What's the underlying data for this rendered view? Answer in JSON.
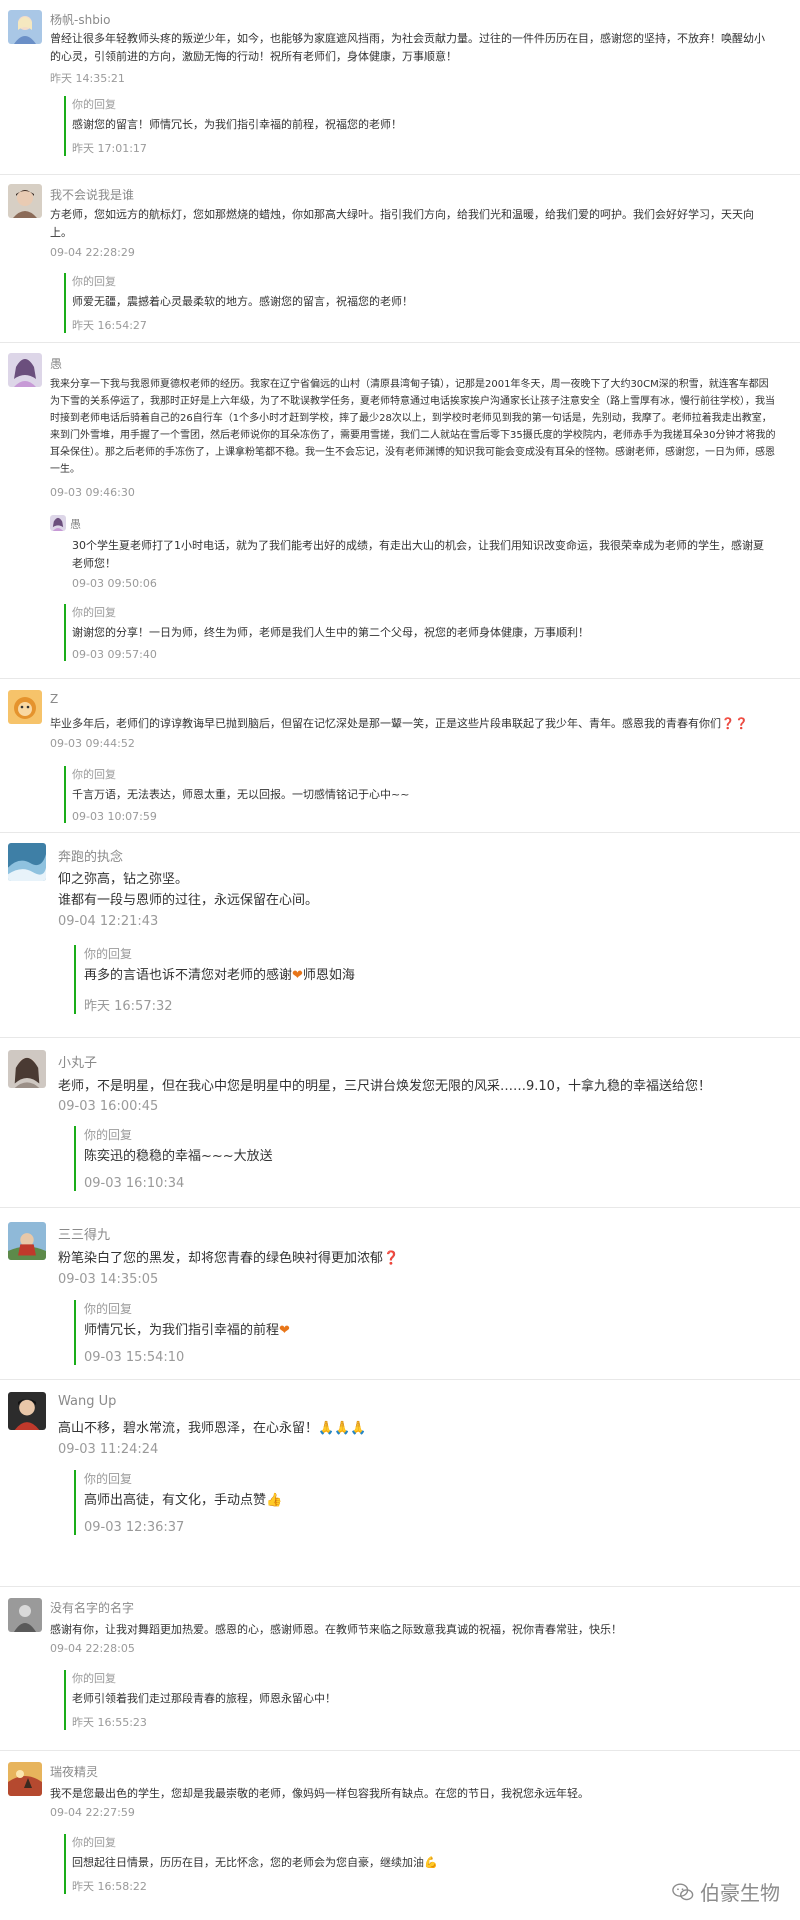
{
  "comments": [
    {
      "nickname": "杨帆-shbio",
      "text": "曾经让很多年轻教师头疼的叛逆少年，如今，也能够为家庭遮风挡雨，为社会贡献力量。过往的一件件历历在目，感谢您的坚持，不放弃！唤醒幼小的心灵，引领前进的方向，激励无悔的行动！祝所有老师们，身体健康，万事顺意！",
      "time": "昨天 14:35:21",
      "reply_label": "你的回复",
      "reply_text": "感谢您的留言！师情冗长，为我们指引幸福的前程，祝福您的老师！",
      "reply_time": "昨天 17:01:17"
    },
    {
      "nickname": "我不会说我是谁",
      "text": "方老师，您如远方的航标灯，您如那燃烧的蜡烛，你如那高大绿叶。指引我们方向，给我们光和温暖，给我们爱的呵护。我们会好好学习，天天向上。",
      "time": "09-04 22:28:29",
      "reply_label": "你的回复",
      "reply_text": "师爱无疆，震撼着心灵最柔软的地方。感谢您的留言，祝福您的老师！",
      "reply_time": "昨天 16:54:27"
    },
    {
      "nickname": "愚",
      "text": "我来分享一下我与我恩师夏德权老师的经历。我家在辽宁省偏远的山村（清原县湾甸子镇），记那是2001年冬天，周一夜晚下了大约30CM深的积雪，就连客车都因为下雪的关系停运了，我那时正好是上六年级，为了不耽误教学任务，夏老师特意通过电话挨家挨户沟通家长让孩子注意安全（路上雪厚有冰，慢行前往学校），我当时接到老师电话后骑着自己的26自行车（1个多小时才赶到学校，摔了最少28次以上，到学校时老师见到我的第一句话是，先别动，我摩了。老师拉着我走出教室，来到门外雪堆，用手握了一个雪团，然后老师说你的耳朵冻伤了，需要用雪搓，我们二人就站在雪后零下35摄氏度的学校院内，老师赤手为我搓耳朵30分钟才将我的耳朵保住）。那之后老师的手冻伤了，上课拿粉笔都不稳。我一生不会忘记，没有老师渊博的知识我可能会变成没有耳朵的怪物。感谢老师，感谢您，一日为师，感恩一生。",
      "time": "09-03 09:46:30",
      "follow_nick": "愚",
      "follow_text": "30个学生夏老师打了1小时电话，就为了我们能考出好的成绩，有走出大山的机会，让我们用知识改变命运，我很荣幸成为老师的学生，感谢夏老师您！",
      "follow_time": "09-03 09:50:06",
      "reply_label": "你的回复",
      "reply_text": "谢谢您的分享！一日为师，终生为师，老师是我们人生中的第二个父母，祝您的老师身体健康，万事顺利！",
      "reply_time": "09-03 09:57:40"
    },
    {
      "nickname": "Z",
      "text": "毕业多年后，老师们的谆谆教诲早已抛到脑后，但留在记忆深处是那一颦一笑，正是这些片段串联起了我少年、青年。感恩我的青春有你们",
      "time": "09-03 09:44:52",
      "reply_label": "你的回复",
      "reply_text": "千言万语，无法表达，师恩太重，无以回报。一切感情铭记于心中~~",
      "reply_time": "09-03 10:07:59"
    },
    {
      "nickname": "奔跑的执念",
      "text": "仰之弥高，钻之弥坚。\n谁都有一段与恩师的过往，永远保留在心间。",
      "time": "09-04 12:21:43",
      "reply_label": "你的回复",
      "reply_text_a": "再多的言语也诉不清您对老师的感谢",
      "reply_text_b": "师恩如海",
      "reply_time": "昨天 16:57:32"
    },
    {
      "nickname": "小丸子",
      "text": "老师，不是明星，但在我心中您是明星中的明星，三尺讲台焕发您无限的风采……9.10，十拿九稳的幸福送给您！",
      "time": "09-03 16:00:45",
      "reply_label": "你的回复",
      "reply_text": "陈奕迅的稳稳的幸福~~~大放送",
      "reply_time": "09-03 16:10:34"
    },
    {
      "nickname": "三三得九",
      "text": "粉笔染白了您的黑发，却将您青春的绿色映衬得更加浓郁",
      "time": "09-03 14:35:05",
      "reply_label": "你的回复",
      "reply_text": "师情冗长，为我们指引幸福的前程",
      "reply_time": "09-03 15:54:10"
    },
    {
      "nickname": "Wang Up",
      "text": "高山不移，碧水常流，我师恩泽，在心永留！",
      "time": "09-03 11:24:24",
      "reply_label": "你的回复",
      "reply_text": "高师出高徒，有文化，手动点赞",
      "reply_time": "09-03 12:36:37"
    },
    {
      "nickname": "没有名字的名字",
      "text": "感谢有你，让我对舞蹈更加热爱。感恩的心，感谢师恩。在教师节来临之际致意我真诚的祝福，祝你青春常驻，快乐！",
      "time": "09-04 22:28:05",
      "reply_label": "你的回复",
      "reply_text": "老师引领着我们走过那段青春的旅程，师恩永留心中！",
      "reply_time": "昨天 16:55:23"
    },
    {
      "nickname": "瑞夜精灵",
      "text": "我不是您最出色的学生，您却是我最崇敬的老师，像妈妈一样包容我所有缺点。在您的节日，我祝您永远年轻。",
      "time": "09-04 22:27:59",
      "reply_label": "你的回复",
      "reply_text": "回想起往日情景，历历在目，无比怀念，您的老师会为您自豪，继续加油",
      "reply_time": "昨天 16:58:22"
    }
  ],
  "watermark": {
    "text": "伯豪生物"
  },
  "colors": {
    "reply_bar": "#1aad19",
    "heart": "#e8761a",
    "qmark": "#d22e2e"
  },
  "emoji": {
    "heart": "❤",
    "qmark": "❓",
    "pray": "🙏",
    "thumb": "👍",
    "muscle": "💪"
  }
}
